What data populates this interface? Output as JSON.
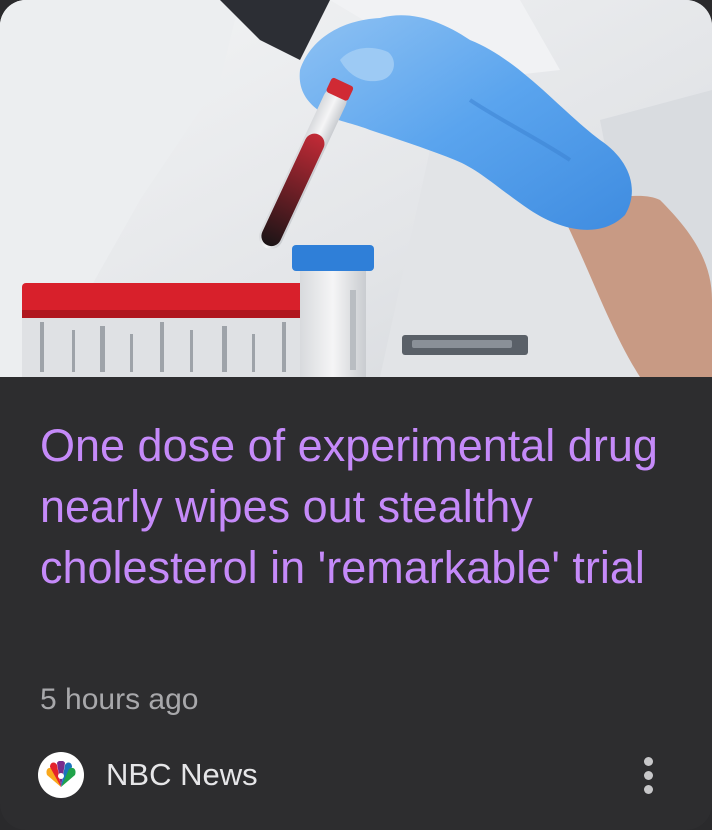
{
  "article": {
    "headline": "One dose of experimental drug nearly wipes out stealthy cholesterol in 'remarkable' trial",
    "time": "5 hours ago",
    "source_name": "NBC News",
    "source_logo_icon": "nbc-peacock-icon",
    "more_icon": "more-vert-icon"
  },
  "colors": {
    "card_bg": "#2d2d2f",
    "headline": "#c58af9",
    "meta_text": "#a8a8ab",
    "source_text": "#e6e6e8"
  }
}
